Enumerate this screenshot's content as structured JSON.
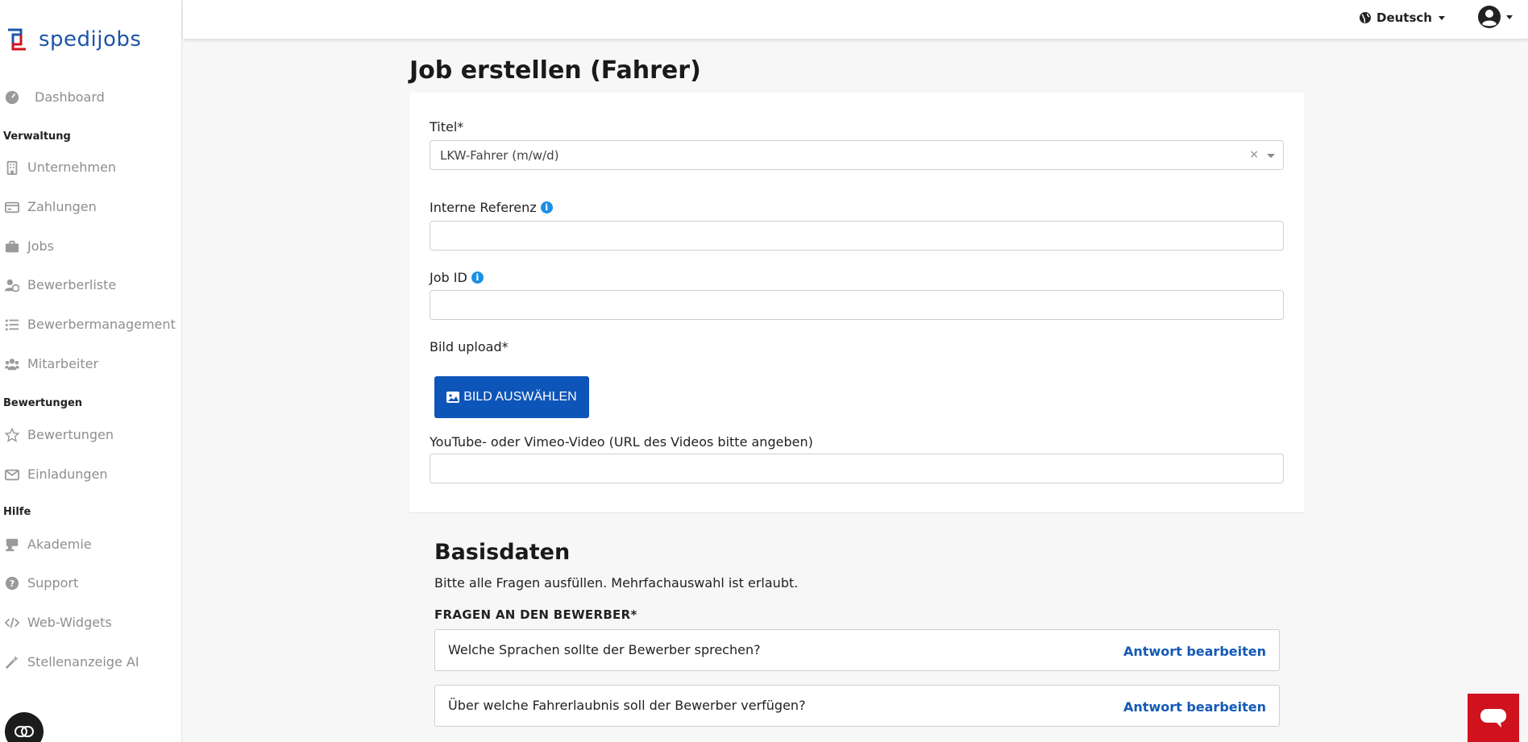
{
  "brand": {
    "name": "spedijobs"
  },
  "sidebar": {
    "dashboard": "Dashboard",
    "sections": {
      "verwaltung": "Verwaltung",
      "bewertungen": "Bewertungen",
      "hilfe": "Hilfe"
    },
    "items": {
      "unternehmen": "Unternehmen",
      "zahlungen": "Zahlungen",
      "jobs": "Jobs",
      "bewerberliste": "Bewerberliste",
      "bewerbermanagement": "Bewerbermanagement",
      "mitarbeiter": "Mitarbeiter",
      "bewertungen": "Bewertungen",
      "einladungen": "Einladungen",
      "akademie": "Akademie",
      "support": "Support",
      "webwidgets": "Web-Widgets",
      "stellenanzeige": "Stellenanzeige AI"
    }
  },
  "topbar": {
    "language": "Deutsch"
  },
  "page": {
    "title": "Job erstellen (Fahrer)"
  },
  "form": {
    "titel_label": "Titel*",
    "titel_value": "LKW-Fahrer (m/w/d)",
    "titel_clear": "×",
    "ref_label": "Interne Referenz",
    "jobid_label": "Job ID",
    "info_glyph": "i",
    "bild_label": "Bild upload*",
    "bild_button": "BILD AUSWÄHLEN",
    "video_label": "YouTube- oder Vimeo-Video (URL des Videos bitte angeben)"
  },
  "basisdaten": {
    "title": "Basisdaten",
    "subtitle": "Bitte alle Fragen ausfüllen. Mehrfachauswahl ist erlaubt.",
    "questions_heading": "FRAGEN AN DEN BEWERBER*",
    "questions": [
      {
        "text": "Welche Sprachen sollte der Bewerber sprechen?",
        "action": "Antwort bearbeiten"
      },
      {
        "text": "Über welche Fahrerlaubnis soll der Bewerber verfügen?",
        "action": "Antwort bearbeiten"
      }
    ]
  },
  "colors": {
    "brand_blue": "#1e55a8",
    "button_blue": "#0d55b8",
    "link_blue": "#1559b5",
    "help_red": "#d0121f",
    "info_blue": "#1a8fe3"
  }
}
